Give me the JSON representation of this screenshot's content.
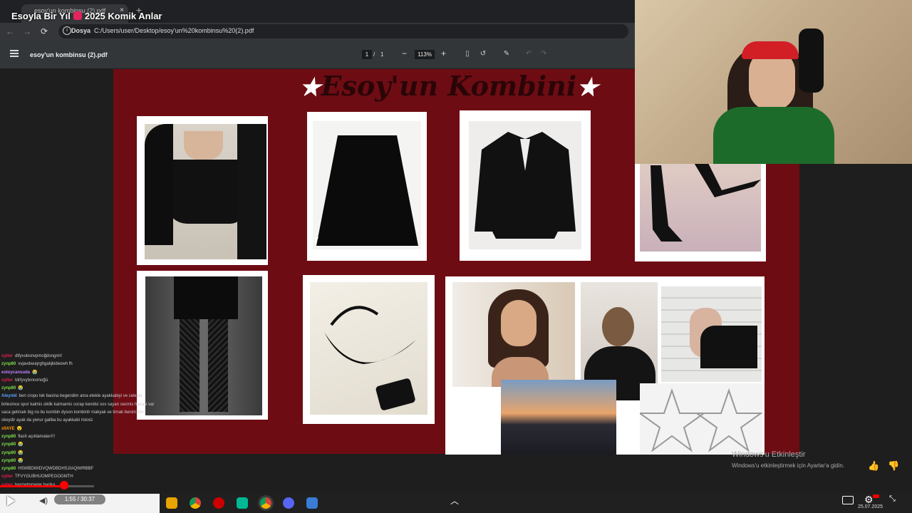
{
  "video": {
    "title_left": "Esoyla Bir Yıl",
    "title_right": "2025 Komik Anlar"
  },
  "browser": {
    "tab_title": "esoy'un kombinsu (2).pdf",
    "tab_close": "×",
    "new_tab": "+",
    "protocol": "Dosya",
    "url": "C:/Users/user/Desktop/esoy'un%20kombinsu%20(2).pdf"
  },
  "pdf": {
    "filename": "esoy'un kombinsu (2).pdf",
    "page_current": "1",
    "page_sep": "/",
    "page_total": "1",
    "zoom": "113%",
    "zoom_minus": "−",
    "zoom_plus": "+",
    "page_title": "Esoy'un Kombini",
    "star": "★"
  },
  "chat": [
    {
      "user": "sytier",
      "msg": "dtfyvubonvpmoğdongmrl",
      "color": "#e0204f"
    },
    {
      "user": "zynp80",
      "msg": "xvjavdwuqrghgakjkideowh fh",
      "color": "#7dde4a"
    },
    {
      "user": "estoycansuda",
      "msg": "😭",
      "color": "#c080ff"
    },
    {
      "user": "sytier",
      "msg": "tdrfyvybınoımoğü",
      "color": "#e0204f"
    },
    {
      "user": "zynp80",
      "msg": "😭",
      "color": "#7dde4a"
    },
    {
      "user": "Aleynbl",
      "msg": "ben cropu tek basina begendim ama etekle ayakkabiyi ve celekle birlesince spor kalmis siklik katmamis corap kendisi sov sayan secmis havasi var saca gelirsek big no bu kombin dyson kombinlr makyak ve tirnak benim icin okeydir ayak da yenur galiba bu ayakkabi riskxiz",
      "color": "#5aa0ff"
    },
    {
      "user": "x0AYE",
      "msg": "😮",
      "color": "#ff9a00"
    },
    {
      "user": "zynp80",
      "msg": "flash açıklamaları!!!",
      "color": "#7dde4a"
    },
    {
      "user": "zynp80",
      "msg": "😭",
      "color": "#7dde4a"
    },
    {
      "user": "zynp80",
      "msg": "😭",
      "color": "#7dde4a"
    },
    {
      "user": "zynp80",
      "msg": "😭",
      "color": "#7dde4a"
    },
    {
      "user": "zynp80",
      "msg": "HSWBDWIDVQWDBDHSJIAQIWRBBF",
      "color": "#7dde4a"
    },
    {
      "user": "sytier",
      "msg": "TFVYGUBHUOMPEGOGMTH",
      "color": "#e0204f"
    },
    {
      "user": "sytier",
      "msg": "benzetmmeler harika",
      "color": "#e0204f"
    }
  ],
  "player": {
    "time": "1:55 / 30:37",
    "progress": 0.0626
  },
  "taskbar": {
    "date": "25.07.2025"
  },
  "windows": {
    "activate_title": "Windows'u Etkinleştir",
    "activate_sub": "Windows'u etkinleştirmek için Ayarlar'a gidin."
  },
  "colors": {
    "pdf_bg": "#6e0c14",
    "accent_red": "#ff0000"
  }
}
